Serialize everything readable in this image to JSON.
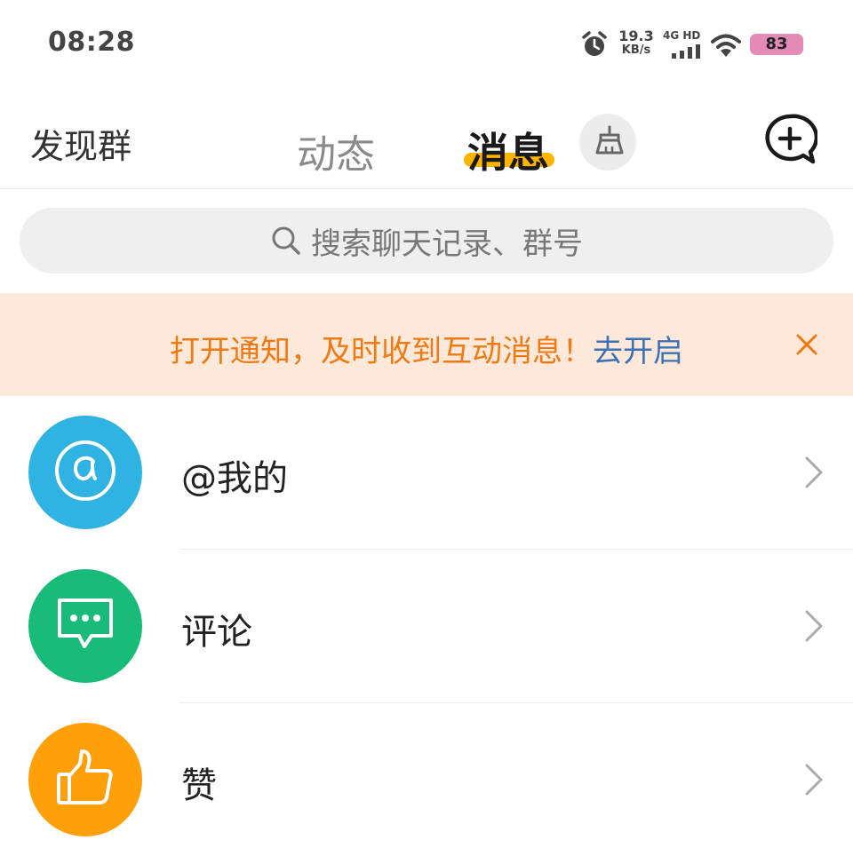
{
  "status_bar": {
    "time": "08:28",
    "net_speed_value": "19.3",
    "net_speed_unit": "KB/s",
    "net_type": "4G HD",
    "battery": "83",
    "battery_color": "#e48ab7"
  },
  "top_nav": {
    "discover_label": "发现群",
    "tabs": [
      {
        "label": "动态",
        "active": false
      },
      {
        "label": "消息",
        "active": true
      }
    ],
    "accent_color": "#ffb400",
    "clean_icon": "broom-icon",
    "add_icon": "add-chat-icon"
  },
  "search": {
    "placeholder": "搜索聊天记录、群号",
    "icon": "search-icon"
  },
  "banner": {
    "message": "打开通知，及时收到互动消息！",
    "link_label": "去开启",
    "text_color": "#f07a12",
    "link_color": "#3c72b5",
    "background": "#fde8da"
  },
  "list": {
    "items": [
      {
        "label": "@我的",
        "icon": "at-icon",
        "color": "#2fb3e3"
      },
      {
        "label": "评论",
        "icon": "comment-icon",
        "color": "#18bb78"
      },
      {
        "label": "赞",
        "icon": "thumbs-up-icon",
        "color": "#ff9f0a"
      }
    ]
  }
}
